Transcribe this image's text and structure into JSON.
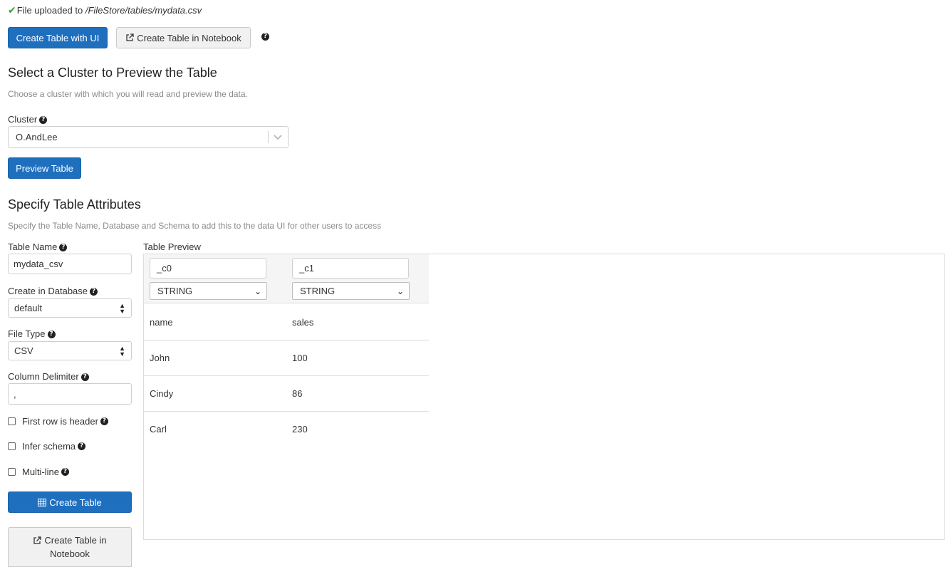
{
  "upload": {
    "prefix": "File uploaded to ",
    "path": "/FileStore/tables/mydata.csv"
  },
  "top_buttons": {
    "create_ui": "Create Table with UI",
    "create_notebook": "Create Table in Notebook"
  },
  "cluster_section": {
    "title": "Select a Cluster to Preview the Table",
    "subtitle": "Choose a cluster with which you will read and preview the data.",
    "cluster_label": "Cluster",
    "cluster_value": "O.AndLee",
    "preview_button": "Preview Table"
  },
  "attributes_section": {
    "title": "Specify Table Attributes",
    "subtitle": "Specify the Table Name, Database and Schema to add this to the data UI for other users to access"
  },
  "form": {
    "table_name_label": "Table Name",
    "table_name_value": "mydata_csv",
    "database_label": "Create in Database",
    "database_value": "default",
    "file_type_label": "File Type",
    "file_type_value": "CSV",
    "delimiter_label": "Column Delimiter",
    "delimiter_value": ",",
    "first_row_header_label": "First row is header",
    "infer_schema_label": "Infer schema",
    "multiline_label": "Multi-line",
    "create_table_button": "Create Table",
    "create_notebook_line1": "Create Table in",
    "create_notebook_line2": "Notebook"
  },
  "preview": {
    "label": "Table Preview",
    "columns": [
      {
        "name": "_c0",
        "type": "STRING"
      },
      {
        "name": "_c1",
        "type": "STRING"
      }
    ],
    "rows": [
      [
        "name",
        "sales"
      ],
      [
        "John",
        "100"
      ],
      [
        "Cindy",
        "86"
      ],
      [
        "Carl",
        "230"
      ]
    ]
  },
  "colors": {
    "primary": "#1f6fbf",
    "success_check": "#3aa13a"
  }
}
